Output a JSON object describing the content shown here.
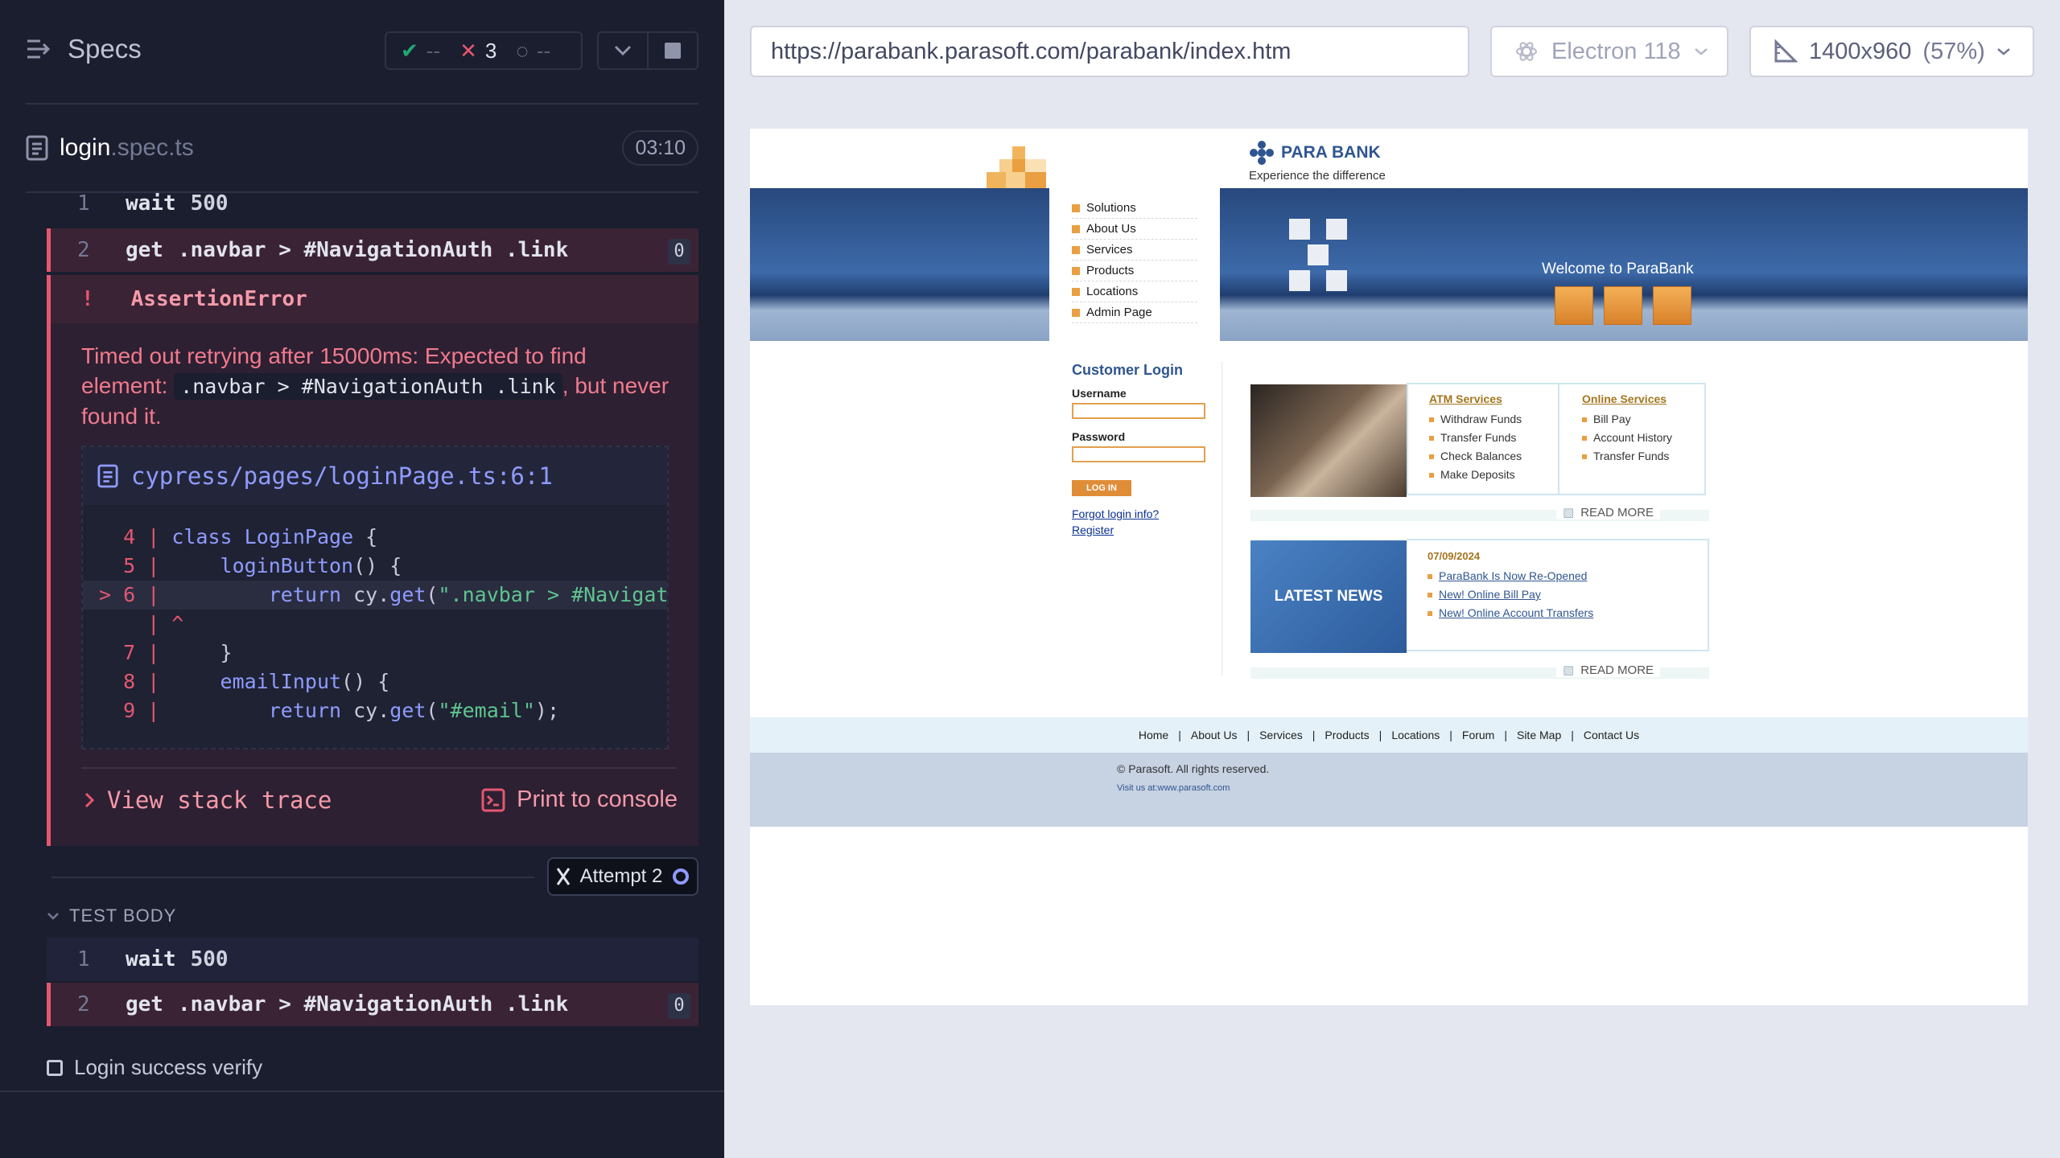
{
  "runner": {
    "specs_title": "Specs",
    "stats": {
      "passed": "--",
      "failed": "3",
      "pending": "--"
    },
    "spec_file": {
      "name": "login",
      "ext": ".spec.ts",
      "duration": "03:10"
    },
    "commands_top": [
      {
        "num": "1",
        "name": "wait",
        "arg": "500"
      },
      {
        "num": "2",
        "name": "get",
        "arg": ".navbar > #NavigationAuth .link",
        "count": "0"
      }
    ],
    "error": {
      "title": "AssertionError",
      "mark": "!",
      "msg_pre": "Timed out retrying after 15000ms: Expected to find element: ",
      "msg_code": ".navbar > #NavigationAuth .link",
      "msg_post": ", but never found it.",
      "file": "cypress/pages/loginPage.ts:6:1",
      "view_stack": "View stack trace",
      "print_console": "Print to console"
    },
    "attempt": "Attempt 2",
    "test_body": "TEST BODY",
    "commands_bottom": [
      {
        "num": "1",
        "name": "wait",
        "arg": "500"
      },
      {
        "num": "2",
        "name": "get",
        "arg": ".navbar > #NavigationAuth .link",
        "count": "0"
      }
    ],
    "next_test": "Login success verify"
  },
  "browser": {
    "url": "https://parabank.parasoft.com/parabank/index.htm",
    "engine": "Electron 118",
    "viewport": "1400x960",
    "zoom": "(57%)"
  },
  "parabank": {
    "logo": "PARA BANK",
    "slogan": "Experience the difference",
    "menu": [
      "Solutions",
      "About Us",
      "Services",
      "Products",
      "Locations",
      "Admin Page"
    ],
    "welcome": "Welcome to ParaBank",
    "login": {
      "title": "Customer Login",
      "username": "Username",
      "password": "Password",
      "button": "LOG IN",
      "forgot": "Forgot login info?",
      "register": "Register"
    },
    "atm": {
      "title": "ATM Services",
      "items": [
        "Withdraw Funds",
        "Transfer Funds",
        "Check Balances",
        "Make Deposits"
      ]
    },
    "online": {
      "title": "Online Services",
      "items": [
        "Bill Pay",
        "Account History",
        "Transfer Funds"
      ]
    },
    "read_more": "READ MORE",
    "news": {
      "label": "LATEST NEWS",
      "date": "07/09/2024",
      "items": [
        "ParaBank Is Now Re-Opened",
        "New! Online Bill Pay",
        "New! Online Account Transfers"
      ]
    },
    "footer_links": [
      "Home",
      "About Us",
      "Services",
      "Products",
      "Locations",
      "Forum",
      "Site Map",
      "Contact Us"
    ],
    "copyright": "© Parasoft. All rights reserved.",
    "visit": "Visit us at:www.parasoft.com"
  }
}
